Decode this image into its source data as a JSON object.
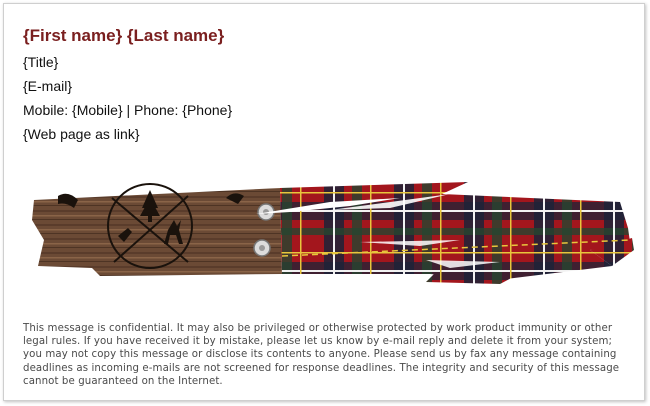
{
  "signature": {
    "name": "{First name} {Last name}",
    "title": "{Title}",
    "email": "{E-mail}",
    "phones": "Mobile: {Mobile} | Phone: {Phone}",
    "web": "{Web page as link}"
  },
  "banner": {
    "icon": "rustic-plaid-banner-image",
    "colors": {
      "wood": "#6b4a35",
      "plaid_red": "#a3161d",
      "plaid_navy": "#1d2338",
      "plaid_green": "#26452f",
      "plaid_yellow": "#e8c63c"
    }
  },
  "disclaimer": "This message is confidential. It may also be privileged or otherwise protected by work product immunity or other legal rules. If you have received it by mistake, please let us know by e-mail reply and delete it from your system; you may not copy this message or disclose its contents to anyone. Please send us by fax any message containing deadlines as incoming e-mails are not screened for response deadlines. The integrity and security of this message cannot be guaranteed on the Internet.",
  "colors": {
    "name": "#7a1f1f",
    "text": "#111111",
    "disclaimer": "#4a4a4a",
    "border": "#cfcfcf"
  }
}
